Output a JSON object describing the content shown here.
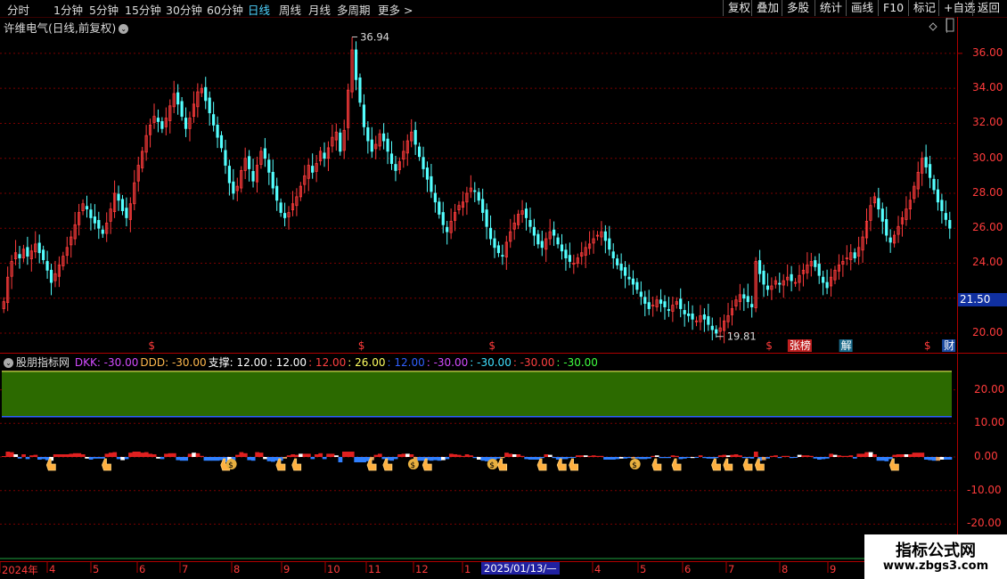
{
  "toolbar": {
    "periods": [
      "分时",
      "1分钟",
      "5分钟",
      "15分钟",
      "30分钟",
      "60分钟",
      "日线",
      "周线",
      "月线",
      "多周期",
      "更多"
    ],
    "active_period": "日线",
    "more_arrow": ">",
    "tools": [
      "复权",
      "叠加",
      "多股",
      "统计",
      "画线",
      "F10",
      "标记",
      "+自选",
      "返回"
    ]
  },
  "chart": {
    "title": "许维电气(日线,前复权)",
    "high_label": "36.94",
    "low_label": "19.81",
    "current_price": "21.50",
    "price_ticks": [
      "36.00",
      "34.00",
      "32.00",
      "30.00",
      "28.00",
      "26.00",
      "24.00",
      "22.00",
      "20.00"
    ],
    "markers": [
      {
        "text": "$",
        "kind": "dollar",
        "day": 37
      },
      {
        "text": "$",
        "kind": "dollar",
        "day": 90
      },
      {
        "text": "$",
        "kind": "dollar",
        "day": 123
      },
      {
        "text": "$",
        "kind": "dollar",
        "day": 193
      },
      {
        "text": "张榜",
        "kind": "tag",
        "day": 199
      },
      {
        "text": "解",
        "kind": "tag2",
        "day": 212
      },
      {
        "text": "$",
        "kind": "dollar",
        "day": 233
      },
      {
        "text": "财",
        "kind": "tag3",
        "day": 238
      }
    ]
  },
  "indicator": {
    "name": "股朋指标网",
    "values": [
      {
        "text": "DKK: -30.00",
        "color": "#d34cff"
      },
      {
        "text": "DDD: -30.00",
        "color": "#ffb84d"
      },
      {
        "text": "支撑: 12.00",
        "color": "#ffffff"
      },
      {
        "text": ": 12.00",
        "color": "#ffffff"
      },
      {
        "text": ": 12.00",
        "color": "#ff4040"
      },
      {
        "text": ": 26.00",
        "color": "#ffff60"
      },
      {
        "text": ": 12.00",
        "color": "#3060ff"
      },
      {
        "text": ": -30.00",
        "color": "#d34cff"
      },
      {
        "text": ": -30.00",
        "color": "#40e0ff"
      },
      {
        "text": ": -30.00",
        "color": "#ff4040"
      },
      {
        "text": ": -30.00",
        "color": "#40ff40"
      }
    ],
    "ticks": [
      "20.00",
      "10.00",
      "0.00",
      "-10.00",
      "-20.00"
    ]
  },
  "dates": {
    "labels": [
      "2024年",
      "4",
      "5",
      "6",
      "7",
      "8",
      "9",
      "10",
      "11",
      "12",
      "1",
      "2025/01/13/—",
      "4",
      "5",
      "6",
      "7",
      "8",
      "9"
    ]
  },
  "watermark": {
    "line1": "指标公式网",
    "line2": "www.zbgs3.com"
  },
  "colors": {
    "up": "#ff3c3c",
    "down": "#54ffff",
    "grid": "#7a0000",
    "green_band": "#2c6a00"
  },
  "chart_data": {
    "type": "candlestick",
    "xlabel": "",
    "ylabel": "",
    "ylim": [
      19,
      37.5
    ],
    "series": [
      {
        "values": [
          21.8,
          23.2,
          24.1,
          24.6,
          24.3,
          24.8,
          24.4,
          24.7,
          25.1,
          24.6,
          24.2,
          23.6,
          22.9,
          23.4,
          23.9,
          24.4,
          24.9,
          25.5,
          26.2,
          26.9,
          27.4,
          27.1,
          26.6,
          26.3,
          26.0,
          25.7,
          26.3,
          27.1,
          28.0,
          27.6,
          27.0,
          26.6,
          27.4,
          28.6,
          29.6,
          30.4,
          31.3,
          31.9,
          32.4,
          32.1,
          31.7,
          32.3,
          33.0,
          33.7,
          33.1,
          32.4,
          31.7,
          32.3,
          33.1,
          33.8,
          34.0,
          33.3,
          32.6,
          31.9,
          31.2,
          30.6,
          29.6,
          28.6,
          28.0,
          28.4,
          29.3,
          30.0,
          29.4,
          28.7,
          29.6,
          30.4,
          30.0,
          29.2,
          28.3,
          27.6,
          26.9,
          26.6,
          26.9,
          27.4,
          27.8,
          28.4,
          29.0,
          29.6,
          29.2,
          29.7,
          30.4,
          30.0,
          30.6,
          31.2,
          31.5,
          30.4,
          31.6,
          33.9,
          36.2,
          34.5,
          33.2,
          31.8,
          31.0,
          30.4,
          30.8,
          31.4,
          31.0,
          30.4,
          29.7,
          29.3,
          29.8,
          30.4,
          31.0,
          31.5,
          30.8,
          30.1,
          29.4,
          28.8,
          28.1,
          27.5,
          26.8,
          26.2,
          25.8,
          26.4,
          26.9,
          27.3,
          27.5,
          28.0,
          28.3,
          28.1,
          27.6,
          26.9,
          26.1,
          25.4,
          24.9,
          24.6,
          24.4,
          25.2,
          25.8,
          26.3,
          26.8,
          27.0,
          26.6,
          26.1,
          25.6,
          25.1,
          24.9,
          25.4,
          25.8,
          25.6,
          25.1,
          24.7,
          24.3,
          24.1,
          24.0,
          24.3,
          24.6,
          24.9,
          25.1,
          25.4,
          25.6,
          25.8,
          25.3,
          24.8,
          24.3,
          23.9,
          23.6,
          23.3,
          23.1,
          22.8,
          22.5,
          22.1,
          21.7,
          21.4,
          21.6,
          21.9,
          21.7,
          21.5,
          21.3,
          21.6,
          21.8,
          21.4,
          21.1,
          21.0,
          20.8,
          20.7,
          21.0,
          20.8,
          20.5,
          20.2,
          20.0,
          20.3,
          20.7,
          21.0,
          21.4,
          21.9,
          22.2,
          22.0,
          21.8,
          21.5,
          24.1,
          23.4,
          22.8,
          22.5,
          22.7,
          23.0,
          22.8,
          23.0,
          23.2,
          23.0,
          22.9,
          23.3,
          23.6,
          23.9,
          24.1,
          23.8,
          23.3,
          22.9,
          22.6,
          23.2,
          23.6,
          23.9,
          24.1,
          24.3,
          24.6,
          24.3,
          24.9,
          25.5,
          26.4,
          27.3,
          27.8,
          27.1,
          26.4,
          25.6,
          25.2,
          25.6,
          26.1,
          26.6,
          27.1,
          27.6,
          28.4,
          29.2,
          30.0,
          29.5,
          28.9,
          28.2,
          27.5,
          27.0,
          26.5,
          26.0
        ]
      }
    ]
  }
}
